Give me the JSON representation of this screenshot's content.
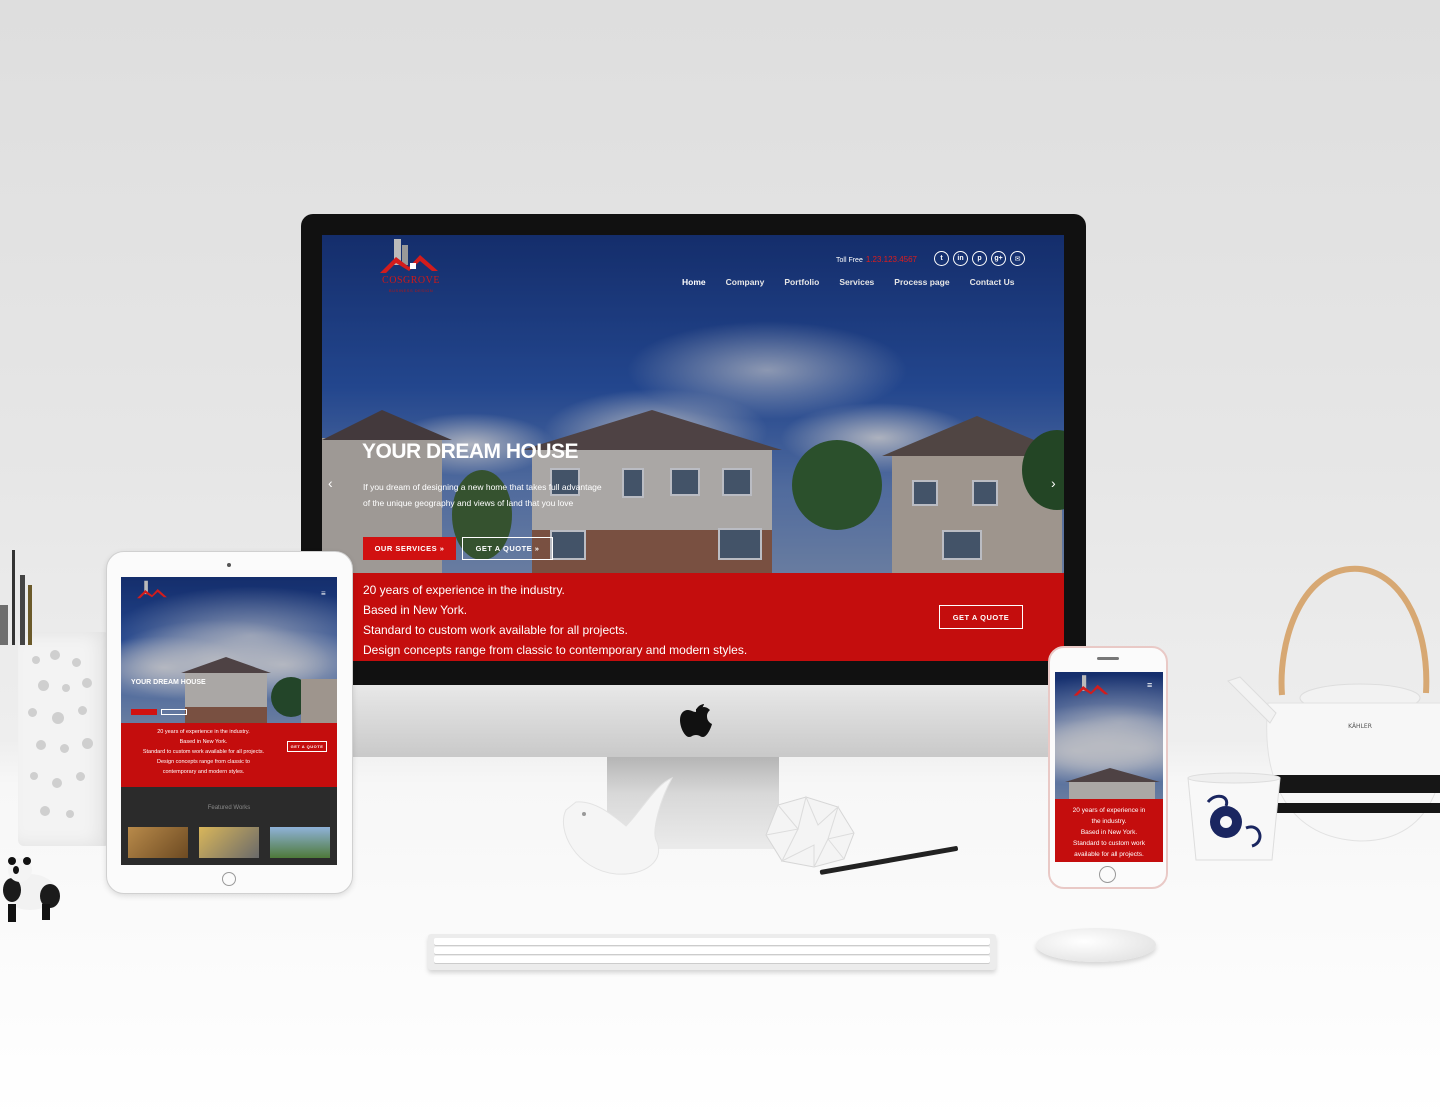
{
  "brand": {
    "logo_name": "COSGROVE",
    "logo_tagline": "BUSINESS DESIGN",
    "accent_color": "#c40d0d"
  },
  "header": {
    "toll_label": "Toll Free",
    "toll_number": "1.23.123.4567",
    "social_icons": [
      "twitter-icon",
      "linkedin-icon",
      "pinterest-icon",
      "google-plus-icon",
      "email-icon"
    ]
  },
  "nav": {
    "items": [
      {
        "label": "Home"
      },
      {
        "label": "Company"
      },
      {
        "label": "Portfolio"
      },
      {
        "label": "Services"
      },
      {
        "label": "Process page"
      },
      {
        "label": "Contact Us"
      }
    ]
  },
  "hero": {
    "title": "YOUR DREAM HOUSE",
    "subtitle_line1": "If you dream of designing a new home that takes full advantage",
    "subtitle_line2": "of the unique geography and views of land that you love",
    "primary_button": "OUR SERVICES »",
    "secondary_button": "GET A QUOTE »"
  },
  "band": {
    "line1": "20 years of experience in the industry.",
    "line2": "Based in New York.",
    "line3": "Standard to custom work available for all projects.",
    "line4": "Design concepts range from classic to contemporary and modern styles.",
    "button": "GET A QUOTE"
  },
  "tablet": {
    "band_lines": [
      "20 years of experience in the industry.",
      "Based in New York.",
      "Standard to custom work available for all projects.",
      "Design concepts range from classic to",
      "contemporary and modern styles."
    ],
    "section_title": "Featured Works"
  },
  "phone": {
    "band_lines": [
      "20 years of experience in",
      "the industry.",
      "Based in New York.",
      "Standard to custom work",
      "available for all projects."
    ]
  },
  "props": {
    "teapot_brand": "KÄHLER"
  }
}
